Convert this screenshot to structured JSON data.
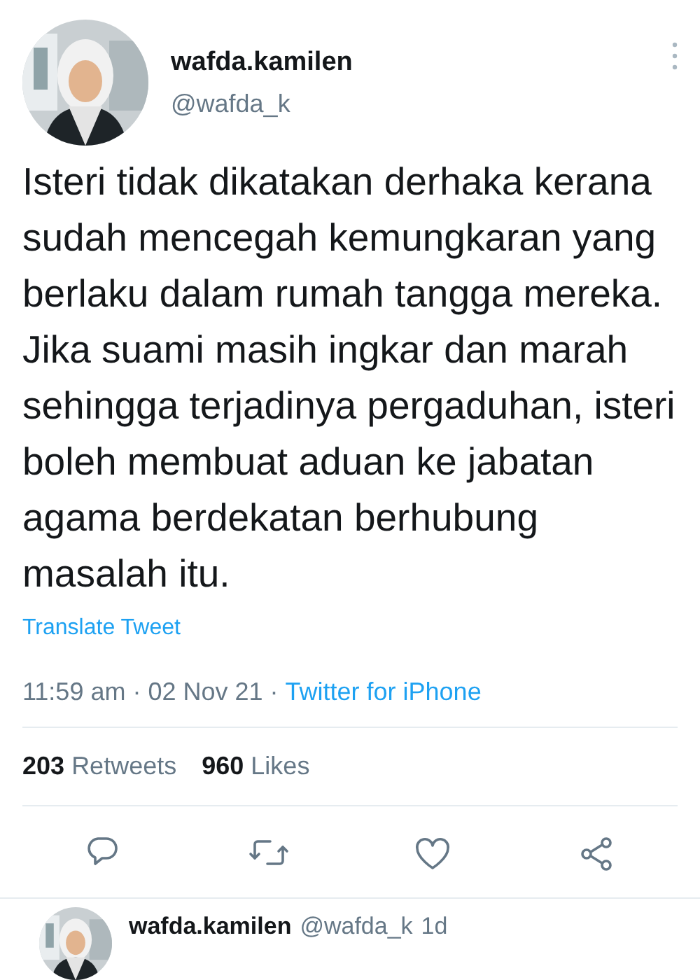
{
  "tweet": {
    "author": {
      "name": "wafda.kamilen",
      "handle": "@wafda_k"
    },
    "text": "Isteri tidak dikatakan derhaka kerana sudah mencegah kemungkaran yang berlaku dalam rumah tangga mereka. Jika suami masih ingkar dan marah sehingga terjadinya pergaduhan, isteri boleh membuat aduan ke jabatan agama berdekatan berhubung masalah itu.",
    "translate_link": "Translate Tweet",
    "timestamp": "11:59 am · 02 Nov 21 · ",
    "source": "Twitter for iPhone",
    "stats": [
      {
        "count": "203",
        "label": "Retweets"
      },
      {
        "count": "960",
        "label": "Likes"
      }
    ],
    "actions": [
      {
        "kind": "reply"
      },
      {
        "kind": "retweet"
      },
      {
        "kind": "like"
      },
      {
        "kind": "share"
      }
    ]
  },
  "reply": {
    "name": "wafda.kamilen",
    "handle": "@wafda_k",
    "time": "1d"
  }
}
